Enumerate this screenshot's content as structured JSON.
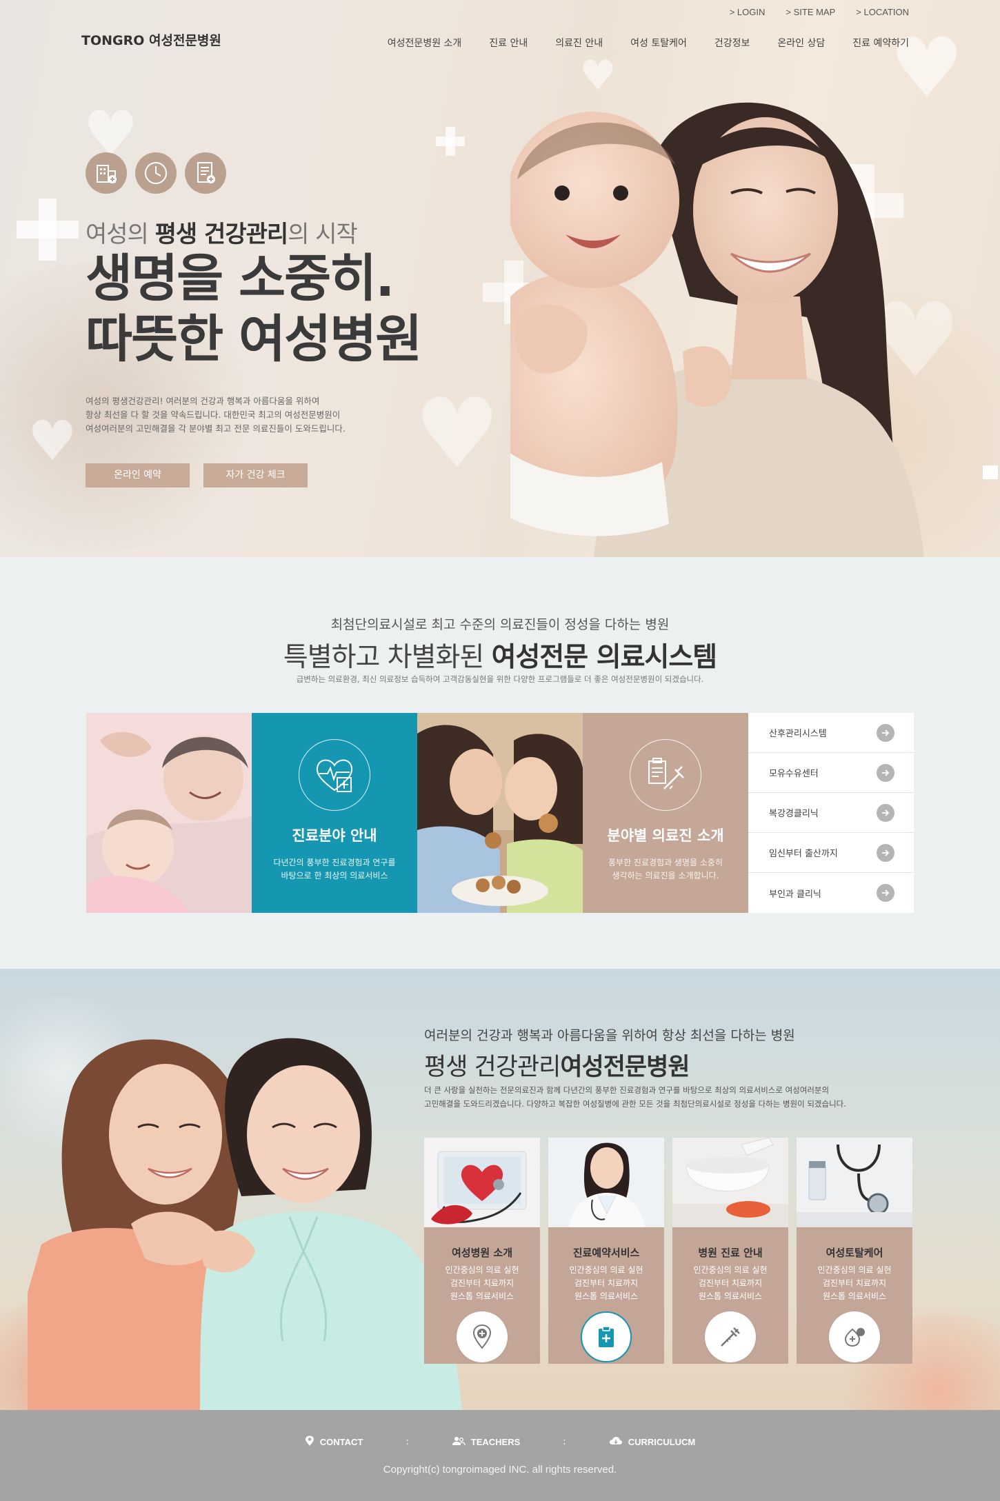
{
  "header": {
    "logo": "TONGRO 여성전문병원",
    "util_links": [
      {
        "label": "LOGIN"
      },
      {
        "label": "SITE MAP"
      },
      {
        "label": "LOCATION"
      }
    ],
    "nav": [
      {
        "label": "여성전문병원 소개"
      },
      {
        "label": "진료 안내"
      },
      {
        "label": "의료진 안내"
      },
      {
        "label": "여성 토탈케어"
      },
      {
        "label": "건강정보"
      },
      {
        "label": "온라인 상담"
      },
      {
        "label": "진료 예약하기"
      }
    ]
  },
  "hero": {
    "icons": [
      "hospital-building-icon",
      "clock-icon",
      "document-icon"
    ],
    "subtitle_pre": "여성의 ",
    "subtitle_bold": "평생 건강관리",
    "subtitle_post": "의 시작",
    "title_line1": "생명을 소중히.",
    "title_line2": "따뜻한 여성병원",
    "desc_line1": "여성의 평생건강관리! 여러분의 건강과 행복과 아름다움을 위하여",
    "desc_line2": "항상 최선을 다 할 것을 약속드립니다. 대한민국 최고의 여성전문병원이",
    "desc_line3": "여성여러분의 고민해결을 각 분야별 최고 전문 의료진들이 도와드립니다.",
    "btn_reserve": "온라인 예약",
    "btn_check": "자가 건강 체크"
  },
  "system": {
    "subtitle": "최첨단의료시설로 최고 수준의 의료진들이 정성을 다하는 병원",
    "title_pre": "특별하고 차별화된 ",
    "title_bold": "여성전문 의료시스템",
    "desc": "급변하는 의료환경, 최신 의료정보 습득하여 고객감동실현을 위한 다양한 프로그램들로 더 좋은 여성전문병원이 되겠습니다.",
    "card_teal": {
      "title": "진료분야 안내",
      "text_line1": "다년간의 풍부한 진료경험과 연구를",
      "text_line2": "바탕으로 한 최상의 의료서비스"
    },
    "card_tan": {
      "title": "분야별 의료진 소개",
      "text_line1": "풍부한 진료경험과 생명을 소중히",
      "text_line2": "생각하는 의료진을 소개합니다."
    },
    "menu": [
      {
        "label": "산후관리시스템"
      },
      {
        "label": "모유수유센터"
      },
      {
        "label": "복강경클리닉"
      },
      {
        "label": "임신부터 출산까지"
      },
      {
        "label": "부인과 클리닉"
      }
    ]
  },
  "lifetime": {
    "subtitle": "여러분의 건강과 행복과 아름다움을 위하여 항상 최선을 다하는 병원",
    "title_pre": "평생 건강관리",
    "title_bold": "여성전문병원",
    "desc_line1": "더 큰 사랑을 실천하는 전문의료진과 함께 다년간의 풍부한 진료경험과 연구를 바탕으로 최상의 의료서비스로 여성여러분의",
    "desc_line2": "고민해결을 도와드리겠습니다. 다양하고 복잡한 여성질병에 관한 모든 것을 최첨단의료시설로 정성을 다하는 병원이 되겠습니다.",
    "services": [
      {
        "title": "여성병원 소개",
        "line1": "인간중심의 의료 실현",
        "line2": "검진부터 치료까지",
        "line3": "원스톱 의료서비스",
        "icon": "location-pin-plus-icon"
      },
      {
        "title": "진료예약서비스",
        "line1": "인간중심의 의료 실현",
        "line2": "검진부터 치료까지",
        "line3": "원스톱 의료서비스",
        "icon": "clipboard-plus-icon"
      },
      {
        "title": "병원 진료 안내",
        "line1": "인간중심의 의료 실현",
        "line2": "검진부터 치료까지",
        "line3": "원스톱 의료서비스",
        "icon": "syringe-icon"
      },
      {
        "title": "여성토탈케어",
        "line1": "인간중심의 의료 실현",
        "line2": "검진부터 치료까지",
        "line3": "원스톱 의료서비스",
        "icon": "pills-drop-icon"
      }
    ]
  },
  "footer": {
    "links": [
      {
        "label": "CONTACT",
        "icon": "location-pin-icon"
      },
      {
        "label": "TEACHERS",
        "icon": "users-icon"
      },
      {
        "label": "CURRICULUCM",
        "icon": "cloud-download-icon"
      }
    ],
    "separator": ":",
    "copyright": "Copyright(c) tongroimaged INC. all rights reserved."
  },
  "colors": {
    "teal": "#1597b2",
    "tan": "#c5a797",
    "button": "#c7aa98",
    "footer": "#a4a4a4"
  }
}
